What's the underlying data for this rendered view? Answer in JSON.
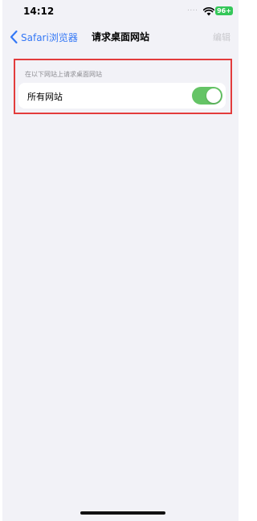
{
  "status_bar": {
    "time": "14:12",
    "signal_text": "....",
    "wifi_icon": "wifi-icon",
    "battery_level": "96+"
  },
  "nav": {
    "back_icon": "chevron-left-icon",
    "back_label": "Safari浏览器",
    "title": "请求桌面网站",
    "edit_label": "编辑"
  },
  "section": {
    "header": "在以下网站上请求桌面网站",
    "rows": [
      {
        "label": "所有网站",
        "toggle_on": true
      }
    ]
  },
  "colors": {
    "accent": "#3478f6",
    "toggle_on": "#65c466",
    "battery": "#34c759",
    "highlight": "#e33c3c",
    "background": "#f2f2f7"
  }
}
